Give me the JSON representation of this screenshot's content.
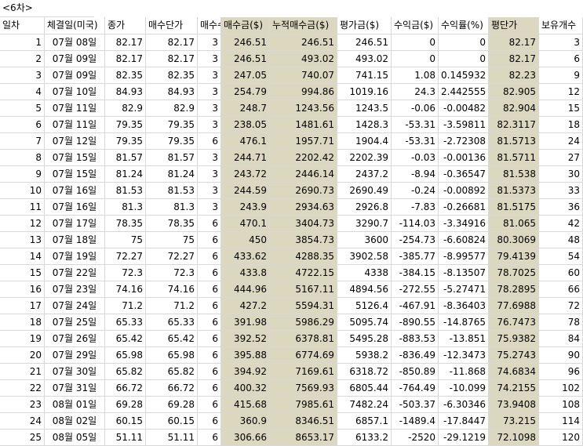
{
  "sheet_title": "<6차>",
  "columns": [
    "일차",
    "체결일(미국)",
    "종가",
    "매수단가",
    "매수수",
    "매수금($)",
    "누적매수금($)",
    "평가금($)",
    "수익금($)",
    "수익률(%)",
    "평단가",
    "보유개수"
  ],
  "rows": [
    [
      "1",
      "07월 08일",
      "82.17",
      "82.17",
      "3",
      "246.51",
      "246.51",
      "246.51",
      "0",
      "0",
      "82.17",
      "3"
    ],
    [
      "2",
      "07월 09일",
      "82.17",
      "82.17",
      "3",
      "246.51",
      "493.02",
      "493.02",
      "0",
      "0",
      "82.17",
      "6"
    ],
    [
      "3",
      "07월 09일",
      "82.35",
      "82.35",
      "3",
      "247.05",
      "740.07",
      "741.15",
      "1.08",
      "0.145932",
      "82.23",
      "9"
    ],
    [
      "4",
      "07월 10일",
      "84.93",
      "84.93",
      "3",
      "254.79",
      "994.86",
      "1019.16",
      "24.3",
      "2.442555",
      "82.905",
      "12"
    ],
    [
      "5",
      "07월 11일",
      "82.9",
      "82.9",
      "3",
      "248.7",
      "1243.56",
      "1243.5",
      "-0.06",
      "-0.00482",
      "82.904",
      "15"
    ],
    [
      "6",
      "07월 11일",
      "79.35",
      "79.35",
      "3",
      "238.05",
      "1481.61",
      "1428.3",
      "-53.31",
      "-3.59811",
      "82.3117",
      "18"
    ],
    [
      "7",
      "07월 12일",
      "79.35",
      "79.35",
      "6",
      "476.1",
      "1957.71",
      "1904.4",
      "-53.31",
      "-2.72308",
      "81.5713",
      "24"
    ],
    [
      "8",
      "07월 15일",
      "81.57",
      "81.57",
      "3",
      "244.71",
      "2202.42",
      "2202.39",
      "-0.03",
      "-0.00136",
      "81.5711",
      "27"
    ],
    [
      "9",
      "07월 15일",
      "81.24",
      "81.24",
      "3",
      "243.72",
      "2446.14",
      "2437.2",
      "-8.94",
      "-0.36547",
      "81.538",
      "30"
    ],
    [
      "10",
      "07월 16일",
      "81.53",
      "81.53",
      "3",
      "244.59",
      "2690.73",
      "2690.49",
      "-0.24",
      "-0.00892",
      "81.5373",
      "33"
    ],
    [
      "11",
      "07월 16일",
      "81.3",
      "81.3",
      "3",
      "243.9",
      "2934.63",
      "2926.8",
      "-7.83",
      "-0.26681",
      "81.5175",
      "36"
    ],
    [
      "12",
      "07월 17일",
      "78.35",
      "78.35",
      "6",
      "470.1",
      "3404.73",
      "3290.7",
      "-114.03",
      "-3.34916",
      "81.065",
      "42"
    ],
    [
      "13",
      "07월 18일",
      "75",
      "75",
      "6",
      "450",
      "3854.73",
      "3600",
      "-254.73",
      "-6.60824",
      "80.3069",
      "48"
    ],
    [
      "14",
      "07월 19일",
      "72.27",
      "72.27",
      "6",
      "433.62",
      "4288.35",
      "3902.58",
      "-385.77",
      "-8.99577",
      "79.4139",
      "54"
    ],
    [
      "15",
      "07월 22일",
      "72.3",
      "72.3",
      "6",
      "433.8",
      "4722.15",
      "4338",
      "-384.15",
      "-8.13507",
      "78.7025",
      "60"
    ],
    [
      "16",
      "07월 23일",
      "74.16",
      "74.16",
      "6",
      "444.96",
      "5167.11",
      "4894.56",
      "-272.55",
      "-5.27471",
      "78.2895",
      "66"
    ],
    [
      "17",
      "07월 24일",
      "71.2",
      "71.2",
      "6",
      "427.2",
      "5594.31",
      "5126.4",
      "-467.91",
      "-8.36403",
      "77.6988",
      "72"
    ],
    [
      "18",
      "07월 25일",
      "65.33",
      "65.33",
      "6",
      "391.98",
      "5986.29",
      "5095.74",
      "-890.55",
      "-14.8765",
      "76.7473",
      "78"
    ],
    [
      "19",
      "07월 26일",
      "65.42",
      "65.42",
      "6",
      "392.52",
      "6378.81",
      "5495.28",
      "-883.53",
      "-13.851",
      "75.9382",
      "84"
    ],
    [
      "20",
      "07월 29일",
      "65.98",
      "65.98",
      "6",
      "395.88",
      "6774.69",
      "5938.2",
      "-836.49",
      "-12.3473",
      "75.2743",
      "90"
    ],
    [
      "21",
      "07월 30일",
      "65.82",
      "65.82",
      "6",
      "394.92",
      "7169.61",
      "6318.72",
      "-850.89",
      "-11.868",
      "74.6834",
      "96"
    ],
    [
      "22",
      "07월 31일",
      "66.72",
      "66.72",
      "6",
      "400.32",
      "7569.93",
      "6805.44",
      "-764.49",
      "-10.099",
      "74.2155",
      "102"
    ],
    [
      "23",
      "08월 01일",
      "69.28",
      "69.28",
      "6",
      "415.68",
      "7985.61",
      "7482.24",
      "-503.37",
      "-6.30346",
      "73.9408",
      "108"
    ],
    [
      "24",
      "08월 02일",
      "60.15",
      "60.15",
      "6",
      "360.9",
      "8346.51",
      "6857.1",
      "-1489.4",
      "-17.8447",
      "73.215",
      "114"
    ],
    [
      "25",
      "08월 05일",
      "51.11",
      "51.11",
      "6",
      "306.66",
      "8653.17",
      "6133.2",
      "-2520",
      "-29.1219",
      "72.1098",
      "120"
    ]
  ]
}
